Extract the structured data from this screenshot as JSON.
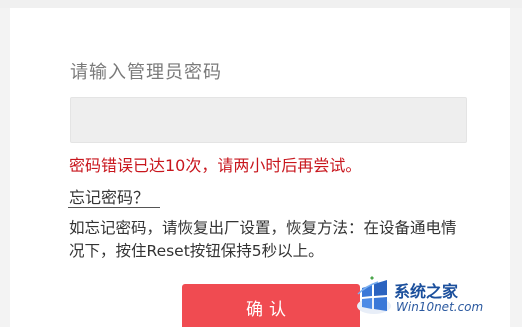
{
  "login": {
    "prompt": "请输入管理员密码",
    "password_value": "",
    "error_message": "密码错误已达10次，请两小时后再尝试。",
    "forgot_link": "忘记密码？",
    "help_text": "如忘记密码，请恢复出厂设置，恢复方法：在设备通电情况下，按住Reset按钮保持5秒以上。",
    "confirm_label": "确认"
  },
  "watermark": {
    "title": "系统之家",
    "subtitle": "Win10net.com",
    "logo_icon": "windows-flag-icon"
  },
  "colors": {
    "error": "#c8161d",
    "button": "#f04b51",
    "input_bg": "#eeeeee"
  }
}
